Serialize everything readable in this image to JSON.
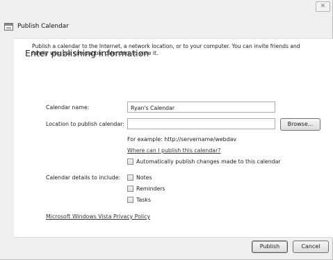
{
  "window": {
    "title": "Publish Calendar",
    "close_glyph": "✕"
  },
  "page": {
    "heading": "Enter publishing information",
    "intro": "Publish a calendar to the Internet, a network location, or to your computer. You can invite friends and family who use compatible calendars to view it."
  },
  "form": {
    "calendar_name_label": "Calendar name:",
    "calendar_name_value": "Ryan's Calendar",
    "location_label": "Location to publish calendar:",
    "location_value": "",
    "browse_label": "Browse...",
    "example_text": "For example: http://servername/webdav",
    "where_link": "Where can I publish this calendar?",
    "auto_publish_label": "Automatically publish changes made to this calendar",
    "auto_publish_checked": false,
    "details_label": "Calendar details to include:",
    "details": [
      {
        "label": "Notes",
        "checked": false
      },
      {
        "label": "Reminders",
        "checked": false
      },
      {
        "label": "Tasks",
        "checked": false
      }
    ],
    "privacy_link": "Microsoft Windows Vista Privacy Policy"
  },
  "buttons": {
    "publish": "Publish",
    "cancel": "Cancel"
  },
  "icons": {
    "app": "calendar-window-icon",
    "close": "close-icon"
  }
}
